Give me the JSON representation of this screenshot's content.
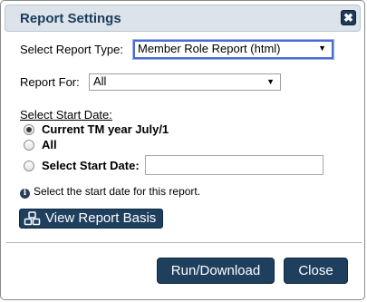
{
  "dialog": {
    "title": "Report Settings",
    "close_icon": "close-x-icon",
    "close_glyph": "✖"
  },
  "report_type": {
    "label": "Select Report Type:",
    "selected": "Member Role Report (html)"
  },
  "report_for": {
    "label": "Report For:",
    "selected": "All"
  },
  "start_date": {
    "section_title": "Select Start Date:",
    "options": [
      {
        "label": "Current TM year July/1",
        "checked": true
      },
      {
        "label": "All",
        "checked": false
      },
      {
        "label": "Select Start Date:",
        "checked": false
      }
    ],
    "date_value": "",
    "info_text": "Select the start date for this report.",
    "info_glyph": "i"
  },
  "basis_button": {
    "label": "View Report Basis",
    "icon": "cubes-icon"
  },
  "footer": {
    "run_label": "Run/Download",
    "close_label": "Close"
  },
  "colors": {
    "accent": "#1f3f5f",
    "title_bar": "#dce3ea",
    "title_text": "#1a3d5c"
  }
}
